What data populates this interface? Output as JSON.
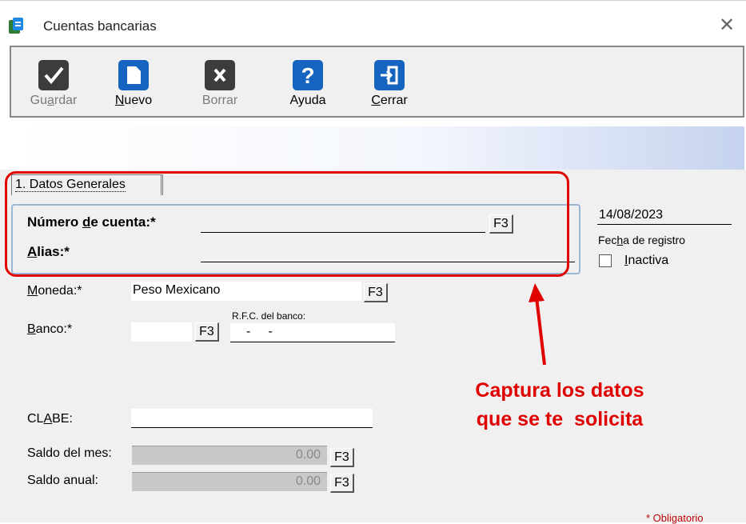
{
  "window": {
    "title": "Cuentas bancarias",
    "close_glyph": "✕"
  },
  "toolbar": {
    "buttons": [
      {
        "label": "Guardar",
        "mnemonic_prefix": "Gu",
        "mnemonic": "a",
        "mnemonic_suffix": "rdar",
        "icon": "checkmark-icon",
        "enabled": false
      },
      {
        "label": "Nuevo",
        "mnemonic_prefix": "",
        "mnemonic": "N",
        "mnemonic_suffix": "uevo",
        "icon": "new-document-icon",
        "enabled": true
      },
      {
        "label": "Borrar",
        "mnemonic_prefix": "",
        "mnemonic": "",
        "mnemonic_suffix": "Borrar",
        "icon": "delete-x-icon",
        "enabled": false
      },
      {
        "label": "Ayuda",
        "mnemonic_prefix": "",
        "mnemonic": "",
        "mnemonic_suffix": "Ayuda",
        "icon": "help-icon",
        "enabled": true
      },
      {
        "label": "Cerrar",
        "mnemonic_prefix": "",
        "mnemonic": "C",
        "mnemonic_suffix": "errar",
        "icon": "exit-icon",
        "enabled": true
      }
    ]
  },
  "tab": {
    "label": "1. Datos Generales"
  },
  "form": {
    "numero_cuenta": {
      "label_pre": "Número ",
      "label_ul": "d",
      "label_post": "e cuenta:*",
      "value": ""
    },
    "alias": {
      "label_ul": "A",
      "label_post": "lias:*",
      "value": ""
    },
    "fecha": {
      "value": "14/08/2023",
      "label_pre": "Fec",
      "label_ul": "h",
      "label_post": "a de registro"
    },
    "inactiva": {
      "label_ul": "I",
      "label_post": "nactiva",
      "checked": false
    },
    "moneda": {
      "label_ul": "M",
      "label_post": "oneda:*",
      "value": "Peso Mexicano"
    },
    "banco": {
      "label_ul": "B",
      "label_post": "anco:*",
      "value": ""
    },
    "rfc": {
      "label": "R.F.C. del banco:",
      "value": "-     -"
    },
    "clabe": {
      "label_pre": "CL",
      "label_ul": "A",
      "label_post": "BE:",
      "value": ""
    },
    "saldo_mes": {
      "label": "Saldo del mes:",
      "value": "0.00"
    },
    "saldo_anual": {
      "label": "Saldo anual:",
      "value": "0.00"
    },
    "f3_label": "F3",
    "obligatorio": "* Obligatorio"
  },
  "annotation": {
    "line1": "Captura los datos",
    "line2": "que se te  solicita"
  },
  "colors": {
    "annotation": "#e00000",
    "icon_dark": "#3c3c3c",
    "icon_blue": "#1565c0"
  }
}
